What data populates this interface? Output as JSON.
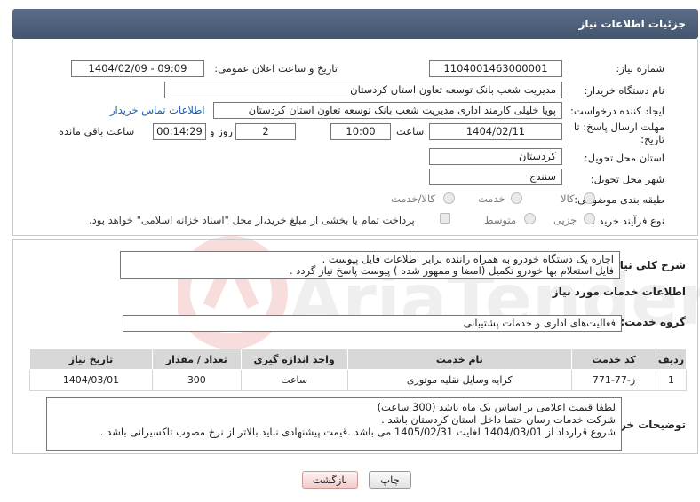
{
  "header": {
    "title": "جزئیات اطلاعات نیاز"
  },
  "form": {
    "need_number_label": "شماره نیاز:",
    "need_number": "1104001463000001",
    "announce_datetime_label": "تاریخ و ساعت اعلان عمومی:",
    "announce_datetime": "1404/02/09 - 09:09",
    "buyer_org_label": "نام دستگاه خریدار:",
    "buyer_org": "مدیریت شعب بانک توسعه تعاون استان کردستان",
    "requester_label": "ایجاد کننده درخواست:",
    "requester": "پویا خلیلی کارمند اداری مدیریت شعب بانک توسعه تعاون استان کردستان",
    "buyer_contact_link": "اطلاعات تماس خریدار",
    "deadline_label_line1": "مهلت ارسال پاسخ: تا",
    "deadline_label_line2": "تاریخ:",
    "deadline_date": "1404/02/11",
    "time_label": "ساعت",
    "deadline_time": "10:00",
    "days_value": "2",
    "days_label": "روز و",
    "remaining_time": "00:14:29",
    "remaining_label": "ساعت باقی مانده",
    "province_label": "استان محل تحویل:",
    "province": "کردستان",
    "city_label": "شهر محل تحویل:",
    "city": "سنندج",
    "category_label": "طبقه بندی موضوعی:",
    "category_options": [
      "کالا",
      "خدمت",
      "کالا/خدمت"
    ],
    "process_label": "نوع فرآیند خرید :",
    "process_options": [
      "جزیی",
      "متوسط"
    ],
    "treasury_note": "پرداخت تمام یا بخشی از مبلغ خرید،از محل \"اسناد خزانه اسلامی\" خواهد بود."
  },
  "summary": {
    "label": "شرح کلی نیاز:",
    "lines": [
      "اجاره یک دستگاه خودرو به همراه راننده برابر اطلاعات فایل پیوست .",
      "فایل استعلام بها خودرو تکمیل (امضا و ممهور شده ) پیوست پاسخ نیاز گردد ."
    ]
  },
  "services": {
    "section_title": "اطلاعات خدمات مورد نیاز",
    "group_label": "گروه خدمت:",
    "group_value": "فعالیت‌های اداری و خدمات پشتیبانی",
    "columns": [
      "ردیف",
      "کد خدمت",
      "نام خدمت",
      "واحد اندازه گیری",
      "تعداد / مقدار",
      "تاریخ نیاز"
    ],
    "rows": [
      [
        "1",
        "ز-77-771",
        "کرایه وسایل نقلیه موتوری",
        "ساعت",
        "300",
        "1404/03/01"
      ]
    ]
  },
  "buyer_notes": {
    "label": "توضیحات خریدار:",
    "lines": [
      "لطفا قیمت اعلامی بر اساس یک ماه باشد (300 ساعت)",
      "شرکت خدمات رسان حتما داخل استان کردستان باشد .",
      "شروع قرارداد از 1404/03/01 لغایت 1405/02/31 می باشد .قیمت پیشنهادی نباید بالاتر از نرخ مصوب تاکسیرانی باشد ."
    ]
  },
  "buttons": {
    "print": "چاپ",
    "back": "بازگشت"
  },
  "watermark": {
    "text": "AriaTender.net"
  },
  "colors": {
    "header_bg": "#4f6079",
    "link": "#1a5fb4",
    "back_button": "#f3caca"
  }
}
